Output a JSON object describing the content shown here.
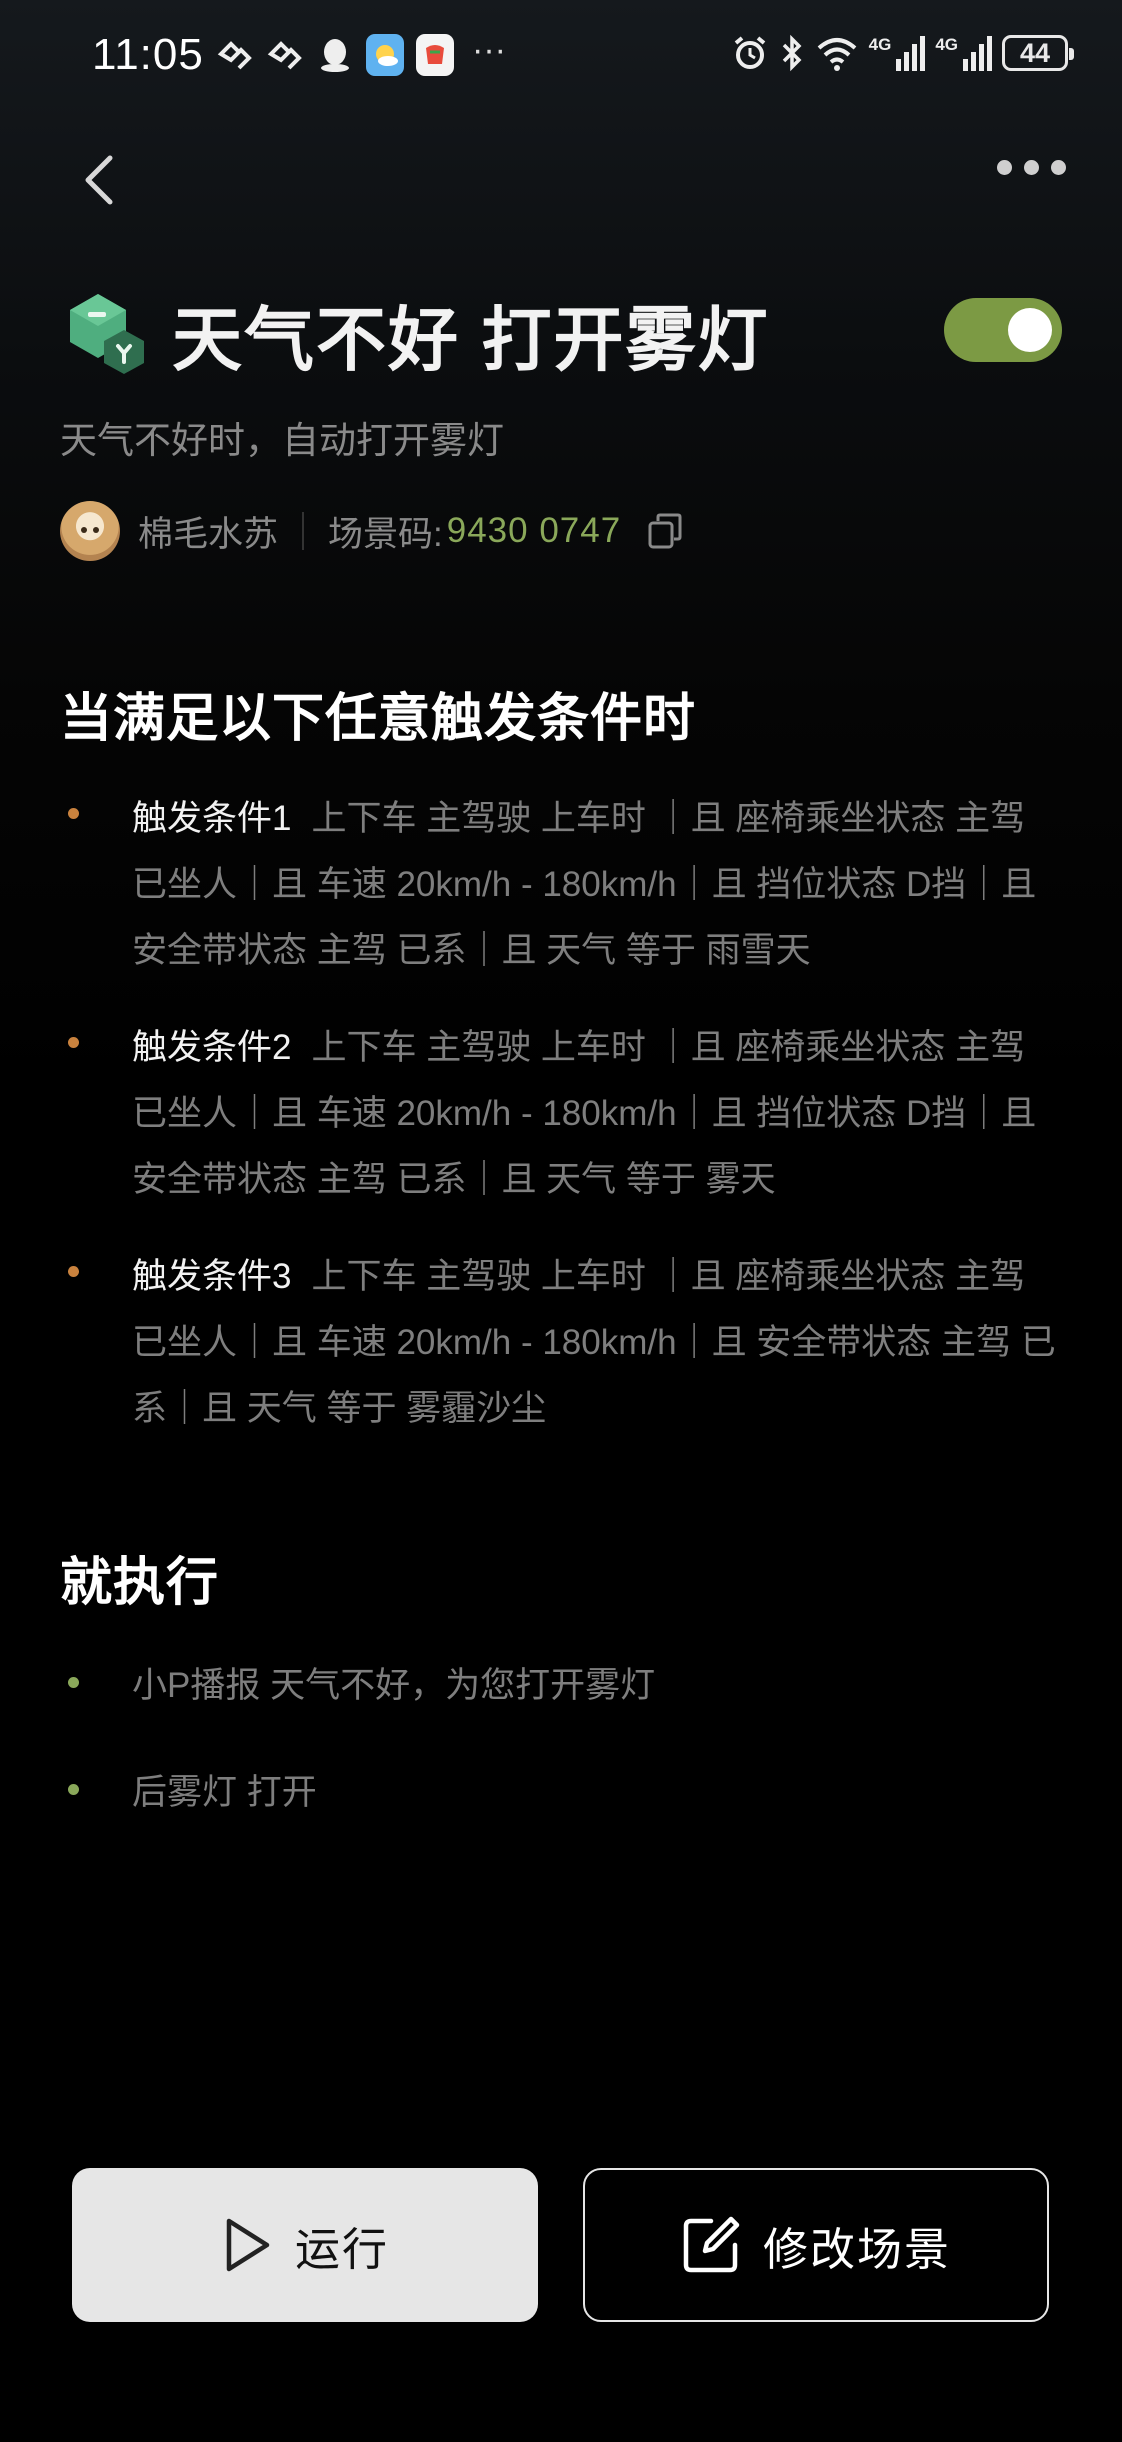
{
  "status_bar": {
    "time": "11:05",
    "battery": "44",
    "network_1": "4G",
    "network_2": "4G"
  },
  "header": {
    "back_icon": "chevron-left-icon",
    "more_icon": "more-dots-icon"
  },
  "scene": {
    "title": "天气不好 打开雾灯",
    "enabled": true,
    "description": "天气不好时，自动打开雾灯",
    "author": "棉毛水苏",
    "code_label": "场景码:",
    "code_value": "9430 0747",
    "accent_color": "#7c9a44"
  },
  "triggers": {
    "heading": "当满足以下任意触发条件时",
    "items": [
      {
        "label": "触发条件1",
        "detail": "上下车 主驾驶 上车时 ｜且 座椅乘坐状态 主驾 已坐人｜且 车速 20km/h - 180km/h｜且 挡位状态 D挡｜且 安全带状态 主驾 已系｜且 天气 等于 雨雪天"
      },
      {
        "label": "触发条件2",
        "detail": "上下车 主驾驶 上车时 ｜且 座椅乘坐状态 主驾 已坐人｜且 车速 20km/h - 180km/h｜且 挡位状态 D挡｜且 安全带状态 主驾 已系｜且 天气 等于 雾天"
      },
      {
        "label": "触发条件3",
        "detail": "上下车 主驾驶 上车时 ｜且 座椅乘坐状态 主驾 已坐人｜且 车速 20km/h - 180km/h｜且 安全带状态 主驾 已系｜且 天气 等于 雾霾沙尘"
      }
    ]
  },
  "actions": {
    "heading": "就执行",
    "items": [
      {
        "text": "小P播报 天气不好，为您打开雾灯"
      },
      {
        "text": "后雾灯 打开"
      }
    ]
  },
  "buttons": {
    "run_label": "运行",
    "edit_label": "修改场景"
  }
}
